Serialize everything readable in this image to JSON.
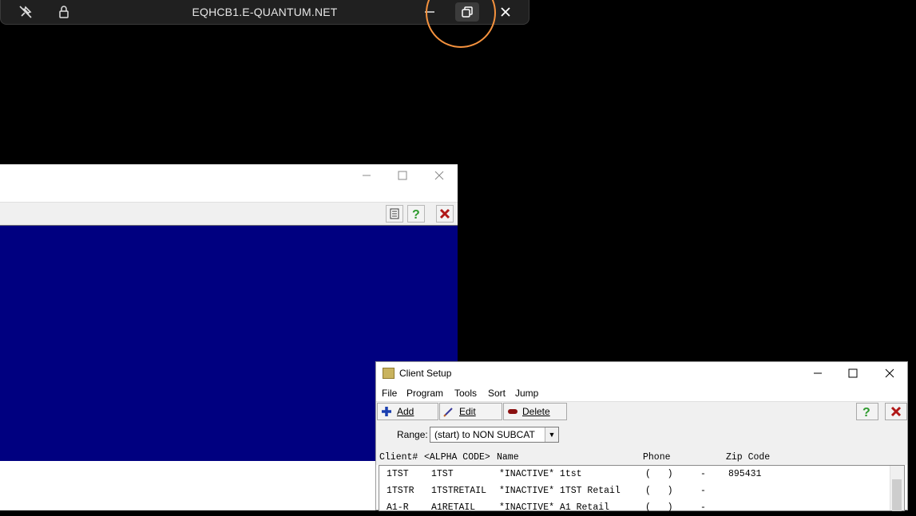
{
  "remote_bar": {
    "title": "EQHCB1.E-QUANTUM.NET",
    "icons": [
      "unpin-icon",
      "lock-icon",
      "minimize-icon",
      "restore-icon",
      "close-icon"
    ]
  },
  "client_window": {
    "title": "Client Setup",
    "menu": [
      "File",
      "Program",
      "Tools",
      "Sort",
      "Jump"
    ],
    "toolbar": {
      "add_label": "Add",
      "edit_label": "Edit",
      "delete_label": "Delete"
    },
    "range_label": "Range:",
    "range_value": "(start) to NON SUBCAT",
    "columns": {
      "client": "Client#",
      "alpha": "<ALPHA CODE>",
      "name": "Name",
      "phone": "Phone",
      "zip": "Zip Code"
    },
    "rows": [
      {
        "client": "1TST",
        "alpha": "1TST",
        "name": "*INACTIVE* 1tst",
        "phone": "(   )     -",
        "zip": "895431"
      },
      {
        "client": "1TSTR",
        "alpha": "1TSTRETAIL",
        "name": "*INACTIVE* 1TST Retail",
        "phone": "(   )     -",
        "zip": ""
      },
      {
        "client": "A1-R",
        "alpha": "A1RETAIL",
        "name": "*INACTIVE* A1 Retail",
        "phone": "(   )     -",
        "zip": ""
      }
    ]
  },
  "colors": {
    "desktop": "#000000",
    "blue_panel": "#000080",
    "highlight_ring": "#f5923e",
    "help_green": "#2e9a2e",
    "close_red": "#b01818"
  }
}
